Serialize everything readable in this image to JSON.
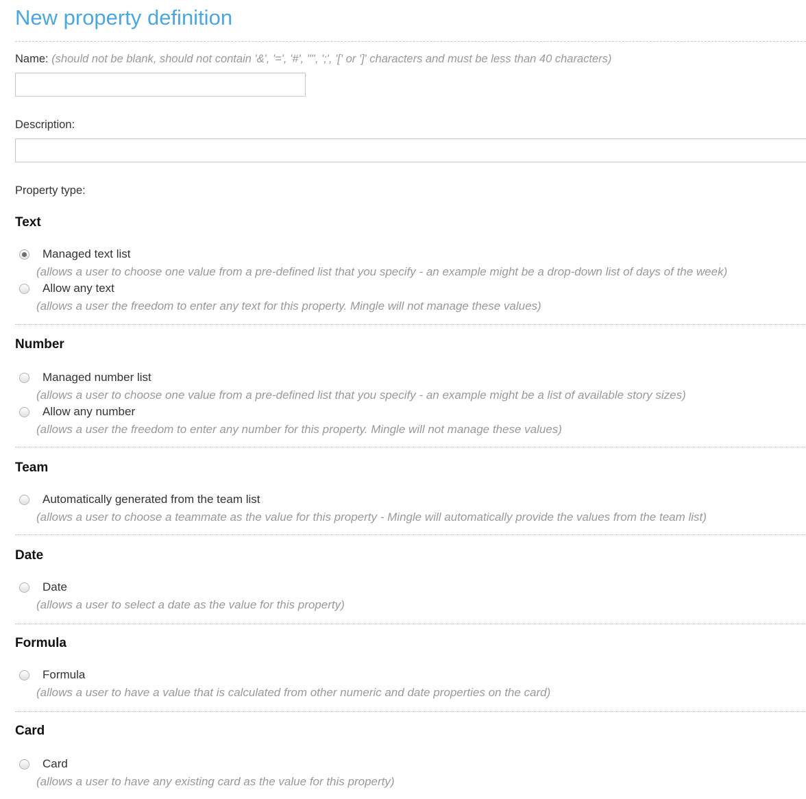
{
  "page_title": "New property definition",
  "name_field": {
    "label": "Name:",
    "hint": "(should not be blank, should not contain '&', '=', '#', '\"', ';', '[' or ']' characters and must be less than 40 characters)",
    "value": ""
  },
  "description_field": {
    "label": "Description:",
    "value": ""
  },
  "property_type_label": "Property type:",
  "sections": [
    {
      "title": "Text",
      "options": [
        {
          "label": "Managed text list",
          "desc": "(allows a user to choose one value from a pre-defined list that you specify - an example might be a drop-down list of days of the week)",
          "checked": true
        },
        {
          "label": "Allow any text",
          "desc": "(allows a user the freedom to enter any text for this property. Mingle will not manage these values)",
          "checked": false
        }
      ]
    },
    {
      "title": "Number",
      "options": [
        {
          "label": "Managed number list",
          "desc": "(allows a user to choose one value from a pre-defined list that you specify - an example might be a list of available story sizes)",
          "checked": false
        },
        {
          "label": "Allow any number",
          "desc": "(allows a user the freedom to enter any number for this property. Mingle will not manage these values)",
          "checked": false
        }
      ]
    },
    {
      "title": "Team",
      "options": [
        {
          "label": "Automatically generated from the team list",
          "desc": "(allows a user to choose a teammate as the value for this property - Mingle will automatically provide the values from the team list)",
          "checked": false
        }
      ]
    },
    {
      "title": "Date",
      "options": [
        {
          "label": "Date",
          "desc": "(allows a user to select a date as the value for this property)",
          "checked": false
        }
      ]
    },
    {
      "title": "Formula",
      "options": [
        {
          "label": "Formula",
          "desc": "(allows a user to have a value that is calculated from other numeric and date properties on the card)",
          "checked": false
        }
      ]
    },
    {
      "title": "Card",
      "options": [
        {
          "label": "Card",
          "desc": "(allows a user to have any existing card as the value for this property)",
          "checked": false
        }
      ]
    }
  ]
}
